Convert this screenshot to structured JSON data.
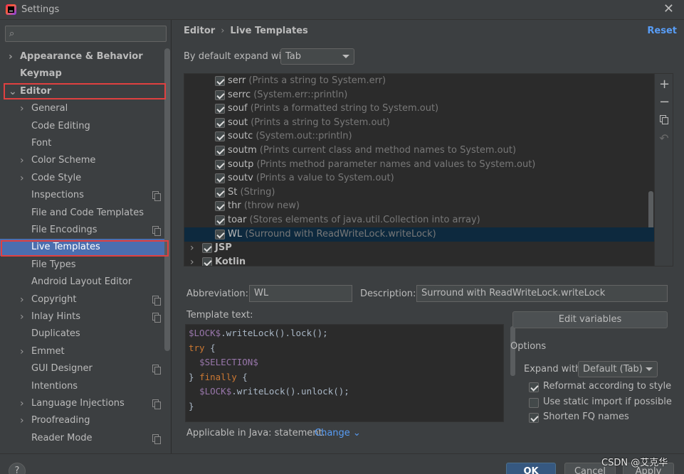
{
  "window": {
    "title": "Settings",
    "close_glyph": "✕"
  },
  "sidebar": {
    "search_placeholder": "",
    "items": [
      {
        "label": "Appearance & Behavior",
        "arrow": "›",
        "bold": true
      },
      {
        "label": "Keymap",
        "arrow": "",
        "bold": true
      },
      {
        "label": "Editor",
        "arrow": "⌄",
        "bold": true
      },
      {
        "label": "General",
        "arrow": "›"
      },
      {
        "label": "Code Editing",
        "arrow": ""
      },
      {
        "label": "Font",
        "arrow": ""
      },
      {
        "label": "Color Scheme",
        "arrow": "›"
      },
      {
        "label": "Code Style",
        "arrow": "›"
      },
      {
        "label": "Inspections",
        "arrow": "",
        "copy": true
      },
      {
        "label": "File and Code Templates",
        "arrow": ""
      },
      {
        "label": "File Encodings",
        "arrow": "",
        "copy": true
      },
      {
        "label": "Live Templates",
        "arrow": "",
        "selected": true
      },
      {
        "label": "File Types",
        "arrow": ""
      },
      {
        "label": "Android Layout Editor",
        "arrow": ""
      },
      {
        "label": "Copyright",
        "arrow": "›",
        "copy": true
      },
      {
        "label": "Inlay Hints",
        "arrow": "›",
        "copy": true
      },
      {
        "label": "Duplicates",
        "arrow": ""
      },
      {
        "label": "Emmet",
        "arrow": "›"
      },
      {
        "label": "GUI Designer",
        "arrow": "",
        "copy": true
      },
      {
        "label": "Intentions",
        "arrow": ""
      },
      {
        "label": "Language Injections",
        "arrow": "›",
        "copy": true
      },
      {
        "label": "Proofreading",
        "arrow": "›"
      },
      {
        "label": "Reader Mode",
        "arrow": "",
        "copy": true
      }
    ]
  },
  "main": {
    "breadcrumb": {
      "parent": "Editor",
      "separator": "›",
      "current": "Live Templates"
    },
    "reset_label": "Reset",
    "expand_label": "By default expand with",
    "expand_value": "Tab",
    "templates": [
      {
        "name": "serr",
        "desc": "(Prints a string to System.err)"
      },
      {
        "name": "serrc",
        "desc": "(System.err::println)"
      },
      {
        "name": "souf",
        "desc": "(Prints a formatted string to System.out)"
      },
      {
        "name": "sout",
        "desc": "(Prints a string to System.out)"
      },
      {
        "name": "soutc",
        "desc": "(System.out::println)"
      },
      {
        "name": "soutm",
        "desc": "(Prints current class and method names to System.out)"
      },
      {
        "name": "soutp",
        "desc": "(Prints method parameter names and values to System.out)"
      },
      {
        "name": "soutv",
        "desc": "(Prints a value to System.out)"
      },
      {
        "name": "St",
        "desc": "(String)"
      },
      {
        "name": "thr",
        "desc": "(throw new)"
      },
      {
        "name": "toar",
        "desc": "(Stores elements of java.util.Collection into array)"
      },
      {
        "name": "WL",
        "desc": "(Surround with ReadWriteLock.writeLock)",
        "selected": true
      }
    ],
    "groups": [
      {
        "name": "JSP",
        "arrow": "›"
      },
      {
        "name": "Kotlin",
        "arrow": "›"
      }
    ],
    "toolbar": {
      "add_glyph": "+",
      "remove_glyph": "−",
      "copy_icon": "copy-icon",
      "restore_glyph": "↶"
    },
    "abbreviation_label": "Abbreviation:",
    "abbreviation_value": "WL",
    "description_label": "Description:",
    "description_value": "Surround with ReadWriteLock.writeLock",
    "template_text_label": "Template text:",
    "code": [
      [
        {
          "t": "$LOCK$",
          "c": "var"
        },
        {
          "t": ".writeLock().lock();",
          "c": ""
        }
      ],
      [
        {
          "t": "try",
          "c": "kw"
        },
        {
          "t": " {",
          "c": ""
        }
      ],
      [
        {
          "t": "  ",
          "c": ""
        },
        {
          "t": "$SELECTION$",
          "c": "var"
        }
      ],
      [
        {
          "t": "} ",
          "c": ""
        },
        {
          "t": "finally",
          "c": "kw"
        },
        {
          "t": " {",
          "c": ""
        }
      ],
      [
        {
          "t": "  ",
          "c": ""
        },
        {
          "t": "$LOCK$",
          "c": "var"
        },
        {
          "t": ".writeLock().unlock();",
          "c": ""
        }
      ],
      [
        {
          "t": "}",
          "c": ""
        }
      ]
    ],
    "edit_variables_label": "Edit variables",
    "options_title": "Options",
    "expand_with_label": "Expand with",
    "expand_with_value": "Default (Tab)",
    "options": [
      {
        "label": "Reformat according to style",
        "checked": true
      },
      {
        "label": "Use static import if possible",
        "checked": false
      },
      {
        "label": "Shorten FQ names",
        "checked": true
      }
    ],
    "applicable_text": "Applicable in Java: statement.",
    "change_label": "Change ⌄"
  },
  "footer": {
    "help_label": "?",
    "ok_label": "OK",
    "cancel_label": "Cancel",
    "apply_label": "Apply"
  },
  "watermark": "CSDN @艾克华",
  "colors": {
    "background": "#3c3f41",
    "selection": "#4b6eaf",
    "list_selection": "#0d293e",
    "link": "#589df6",
    "highlight_box": "#e04040"
  }
}
